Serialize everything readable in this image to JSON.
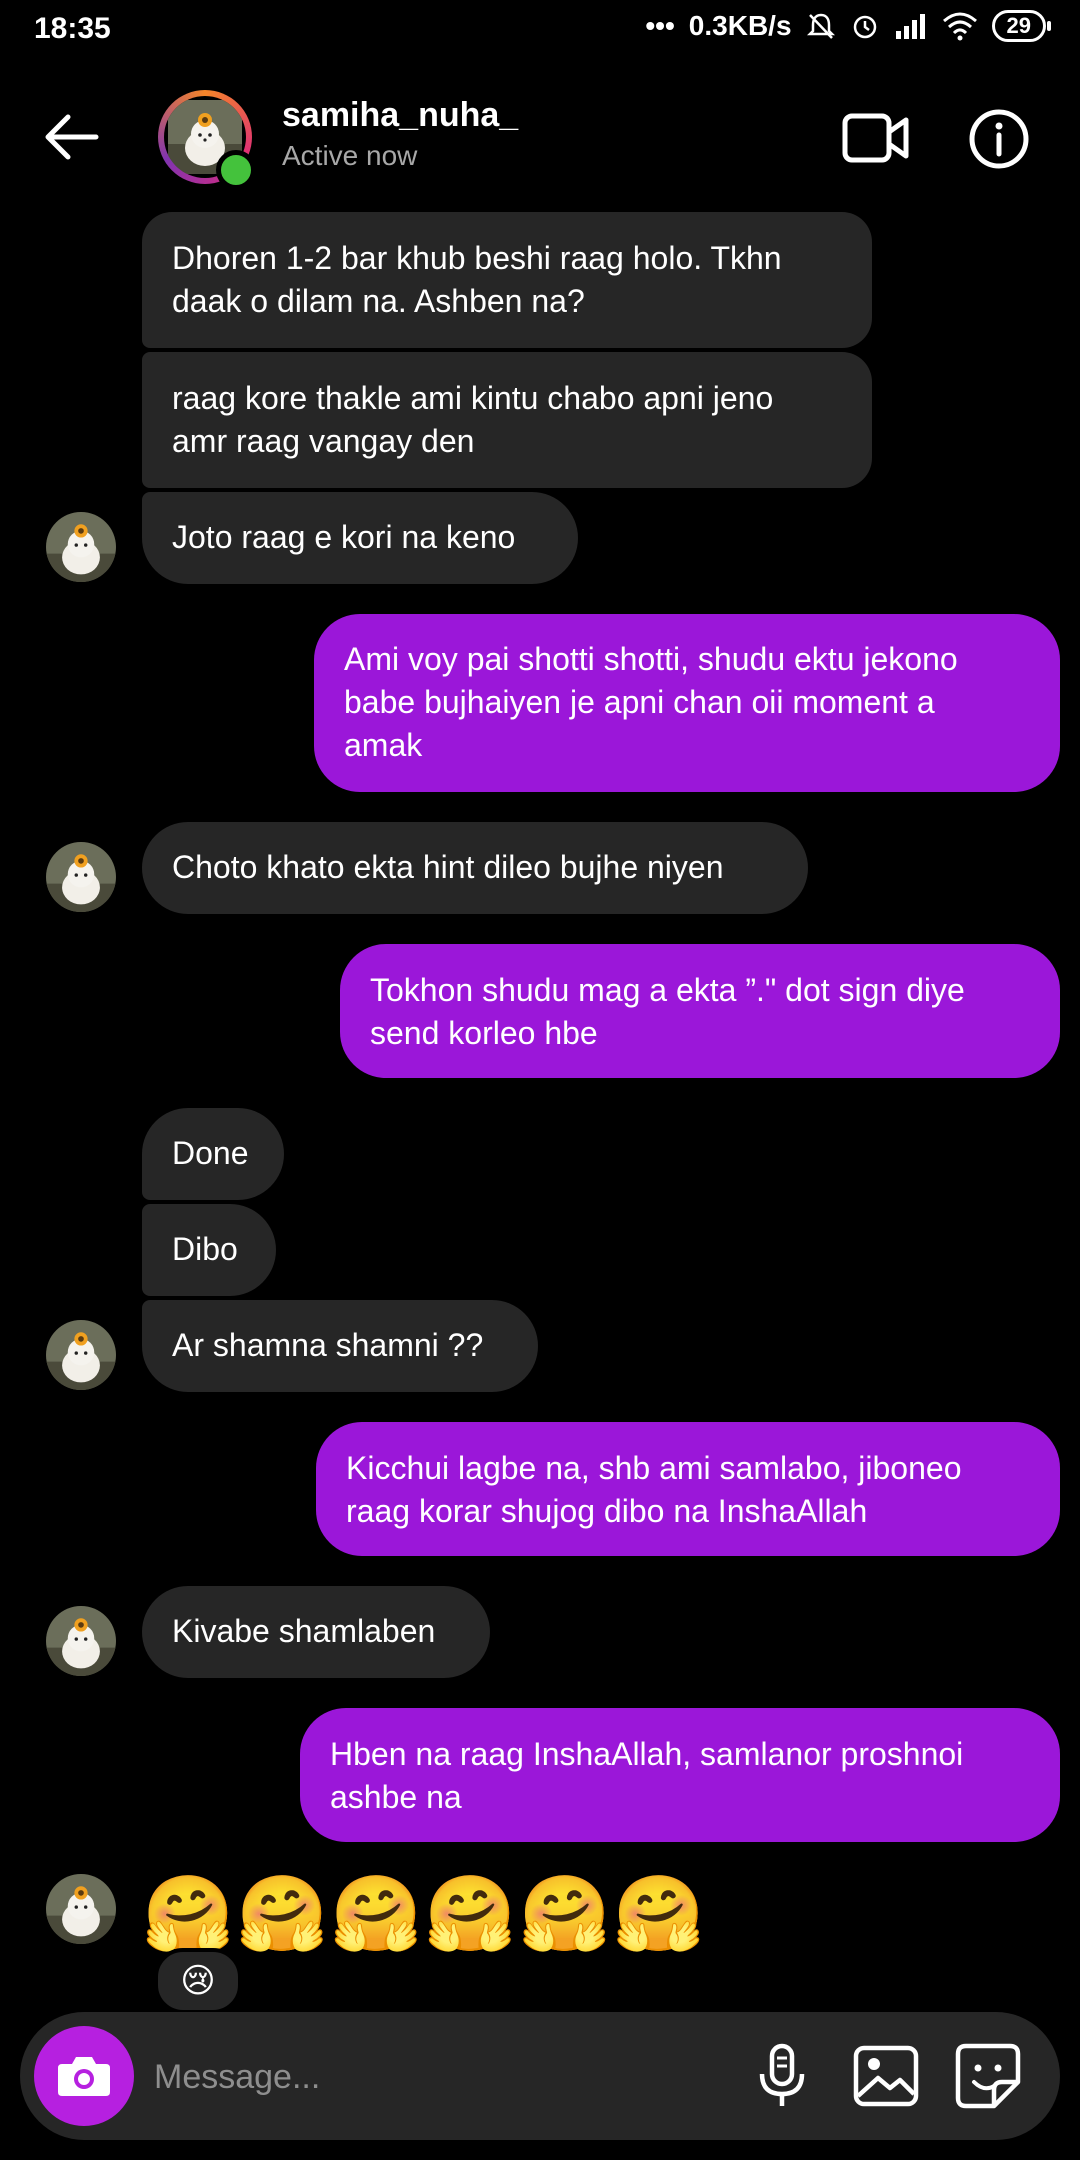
{
  "status_bar": {
    "time": "18:35",
    "net_speed": "0.3KB/s",
    "battery": "29"
  },
  "header": {
    "username": "samiha_nuha_",
    "status": "Active now",
    "icons": [
      "back-arrow-icon",
      "video-call-icon",
      "info-icon"
    ]
  },
  "messages": [
    {
      "from": "them",
      "lines": [
        "Dhoren 1-2 bar khub beshi raag holo. Tkhn",
        "daak o dilam na. Ashben na?"
      ]
    },
    {
      "from": "them",
      "lines": [
        "raag kore thakle ami kintu chabo apni jeno",
        "amr raag vangay den"
      ]
    },
    {
      "from": "them",
      "lines": [
        "Joto raag e kori na keno"
      ]
    },
    {
      "from": "me",
      "lines": [
        "Ami voy pai shotti shotti, shudu ektu jekono",
        "babe bujhaiyen je apni chan oii moment a",
        "amak"
      ]
    },
    {
      "from": "them",
      "lines": [
        "Choto khato ekta hint dileo bujhe niyen"
      ]
    },
    {
      "from": "me",
      "lines": [
        "Tokhon shudu mag a ekta ”.\" dot sign diye",
        "send korleo hbe"
      ]
    },
    {
      "from": "them",
      "lines": [
        "Done"
      ]
    },
    {
      "from": "them",
      "lines": [
        "Dibo"
      ]
    },
    {
      "from": "them",
      "lines": [
        "Ar shamna shamni ??"
      ]
    },
    {
      "from": "me",
      "lines": [
        "Kicchui lagbe na, shb ami samlabo, jiboneo",
        "raag korar shujog dibo na InshaAllah"
      ]
    },
    {
      "from": "them",
      "lines": [
        "Kivabe shamlaben"
      ]
    },
    {
      "from": "me",
      "lines": [
        "Hben na raag InshaAllah, samlanor proshnoi",
        "ashbe na"
      ]
    }
  ],
  "last_message": {
    "emojis": "🤗🤗🤗🤗🤗🤗",
    "reaction": "😢"
  },
  "composer": {
    "placeholder": "Message...",
    "icons": [
      "camera-icon",
      "microphone-icon",
      "gallery-icon",
      "sticker-icon"
    ]
  },
  "colors": {
    "background": "#000000",
    "incoming_bubble": "#262626",
    "outgoing_bubble": "#9b17d9",
    "camera_button": "#b620e0",
    "online_dot": "#44c23c"
  }
}
